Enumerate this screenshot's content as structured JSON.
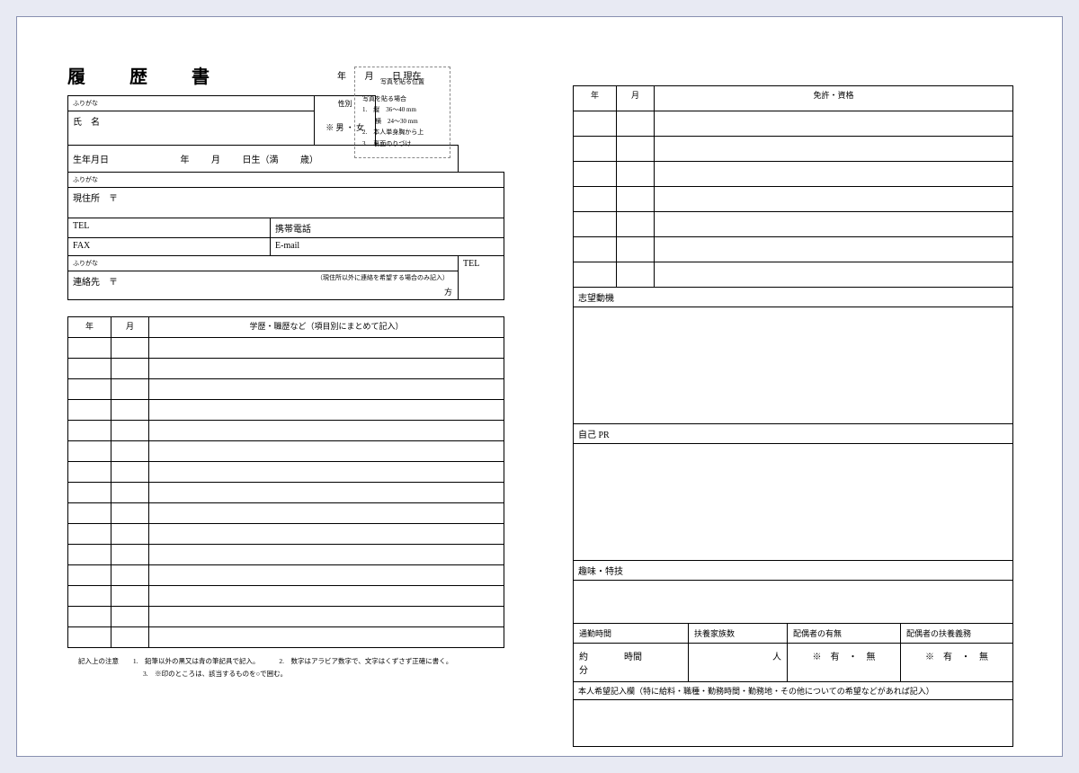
{
  "title": "履 歴 書",
  "date": {
    "year": "年",
    "month": "月",
    "day": "日 現在"
  },
  "photo": {
    "head": "写真を貼る位置",
    "sub": "写真を貼る場合",
    "l1": "1.　縦　36～40 mm",
    "l2": "　　横　24～30 mm",
    "l3": "2.　本人単身胸から上",
    "l4": "3.　裏面のりづけ"
  },
  "labels": {
    "furigana": "ふりがな",
    "name": "氏　名",
    "sex_label": "性別",
    "sex_val": "※ 男 ・ 女",
    "dob_label": "生年月日",
    "address_label": "現住所　〒",
    "tel": "TEL",
    "fax": "FAX",
    "mobile": "携帯電話",
    "email": "E-mail",
    "contact_label": "連絡先　〒",
    "contact_note": "（現住所以外に連絡を希望する場合のみ記入）",
    "contact_side": "方"
  },
  "dob": {
    "y": "年",
    "m": "月",
    "d": "日生（満",
    "age": "歳）"
  },
  "hist_head": {
    "y": "年",
    "m": "月",
    "name": "学歴・職歴など（項目別にまとめて記入）"
  },
  "hist_rows": 15,
  "foot": {
    "h": "記入上の注意",
    "n1": "1.　鉛筆以外の黒又は青の筆記具で記入。",
    "n2": "2.　数字はアラビア数字で、文字はくずさず正確に書く。",
    "n3": "3.　※印のところは、該当するものを○で囲む。"
  },
  "lic_head": {
    "y": "年",
    "m": "月",
    "name": "免許・資格"
  },
  "lic_rows": 7,
  "sections": {
    "motive": "志望動機",
    "pr": "自己 PR",
    "hobby": "趣味・特技"
  },
  "commute": {
    "label": "通勤時間",
    "val": "約　　　　時間　　　　分",
    "dep_label": "扶養家族数",
    "dep_val": "人",
    "spouse_label": "配偶者の有無",
    "spouse_val": "※　有　・　無",
    "duty_label": "配偶者の扶養義務",
    "duty_val": "※　有　・　無"
  },
  "wish": "本人希望記入欄（特に給料・職種・勤務時間・勤務地・その他についての希望などがあれば記入）"
}
